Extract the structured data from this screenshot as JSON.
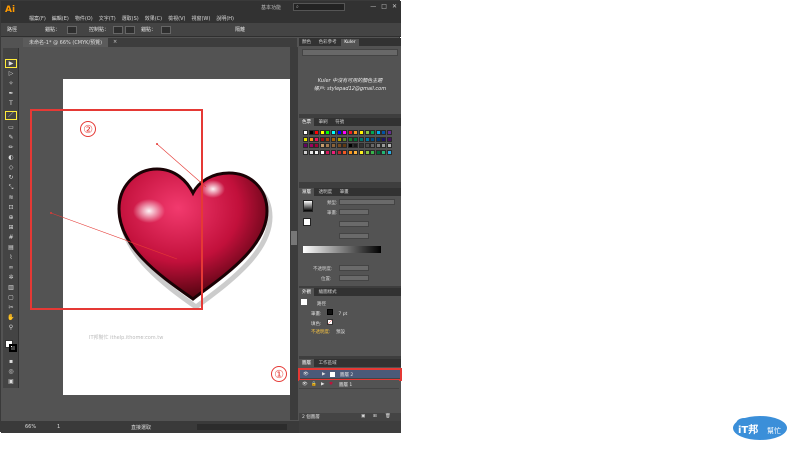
{
  "app": {
    "logo": "Ai",
    "menus": [
      "檔案(F)",
      "編輯(E)",
      "物件(O)",
      "文字(T)",
      "選取(S)",
      "效果(C)",
      "檢視(V)",
      "視窗(W)",
      "說明(H)"
    ],
    "workspace": "基本功能",
    "search_placeholder": "",
    "win_buttons": [
      "—",
      "□",
      "✕"
    ]
  },
  "control_bar": {
    "label_path": "路徑",
    "label_anchor": "錨點：",
    "label_handle": "控制點：",
    "label_anchor2": "錨點：",
    "label_isolate": "隔離"
  },
  "document": {
    "tab": "未命名-1* @ 66% (CMYK/預覽)"
  },
  "canvas": {
    "watermark": "IT邦幫忙 ithelp.ithome.com.tw",
    "watermark2": "- - - -",
    "annotation_1": "①",
    "annotation_2": "②"
  },
  "status": {
    "zoom": "66%",
    "page": "1",
    "tool": "直接選取"
  },
  "kuler_panel": {
    "tabs": [
      "顏色",
      "色彩參考",
      "Kuler"
    ],
    "active_tab": 2,
    "line1": "Kuler 中沒有可用的顏色主題",
    "line2": "帳戶: stylepad12@gmail.com"
  },
  "swatches_panel": {
    "tabs": [
      "色票",
      "筆刷",
      "符號"
    ],
    "active_tab": 0,
    "rows": [
      [
        "#ffffff",
        "#000000",
        "#ff0000",
        "#ffff00",
        "#00ff00",
        "#00ffff",
        "#0000ff",
        "#ff00ff",
        "#ed1c24",
        "#f7941d",
        "#fff200",
        "#8dc63f",
        "#00a651",
        "#00aeef",
        "#0054a6",
        "#662d91"
      ],
      [
        "#e5e500",
        "#f7941d",
        "#ed145b",
        "#9e0b0f",
        "#a0410d",
        "#a36209",
        "#aba000",
        "#598527",
        "#1a7b30",
        "#007236",
        "#00746b",
        "#0076a3",
        "#004b80",
        "#003471",
        "#1b1464",
        "#440e62"
      ],
      [
        "#630460",
        "#9e005d",
        "#9e0039",
        "#c69c6d",
        "#a67c52",
        "#8c6239",
        "#754c24",
        "#603913",
        "#000000",
        "#1a1a1a",
        "#333333",
        "#4d4d4d",
        "#666666",
        "#808080",
        "#999999",
        "#b3b3b3"
      ],
      [
        "#cccccc",
        "#e6e6e6",
        "#f2f2f2",
        "#ffffff",
        "#d4145a",
        "#ed1e79",
        "#c1272d",
        "#f15a24",
        "#f7931e",
        "#fbb03b",
        "#fcee21",
        "#8cc63f",
        "#39b54a",
        "#006837",
        "#22b573",
        "#29abe2"
      ]
    ]
  },
  "gradient_panel": {
    "tabs": [
      "漸層",
      "透明度",
      "筆畫",
      "繪圖"
    ],
    "active_tab": 0,
    "type_label": "類型:",
    "stroke_label": "筆畫:",
    "opacity_label": "不透明度:",
    "position_label": "位置:"
  },
  "appearance_panel": {
    "tabs": [
      "外觀",
      "繪圖樣式"
    ],
    "title": "路徑",
    "stroke_label": "筆畫:",
    "stroke_value": "7 pt",
    "fill_label": "填色:",
    "opacity_label": "不透明度:",
    "opacity_value": "預設"
  },
  "layers_panel": {
    "tabs": [
      "圖層",
      "工作區域"
    ],
    "active_tab": 0,
    "rows": [
      {
        "name": "圖層 2",
        "selected": true
      },
      {
        "name": "圖層 1",
        "selected": false
      }
    ],
    "count": "2 個圖層"
  },
  "brand": {
    "text1": "iT邦",
    "text2": "幫忙"
  }
}
